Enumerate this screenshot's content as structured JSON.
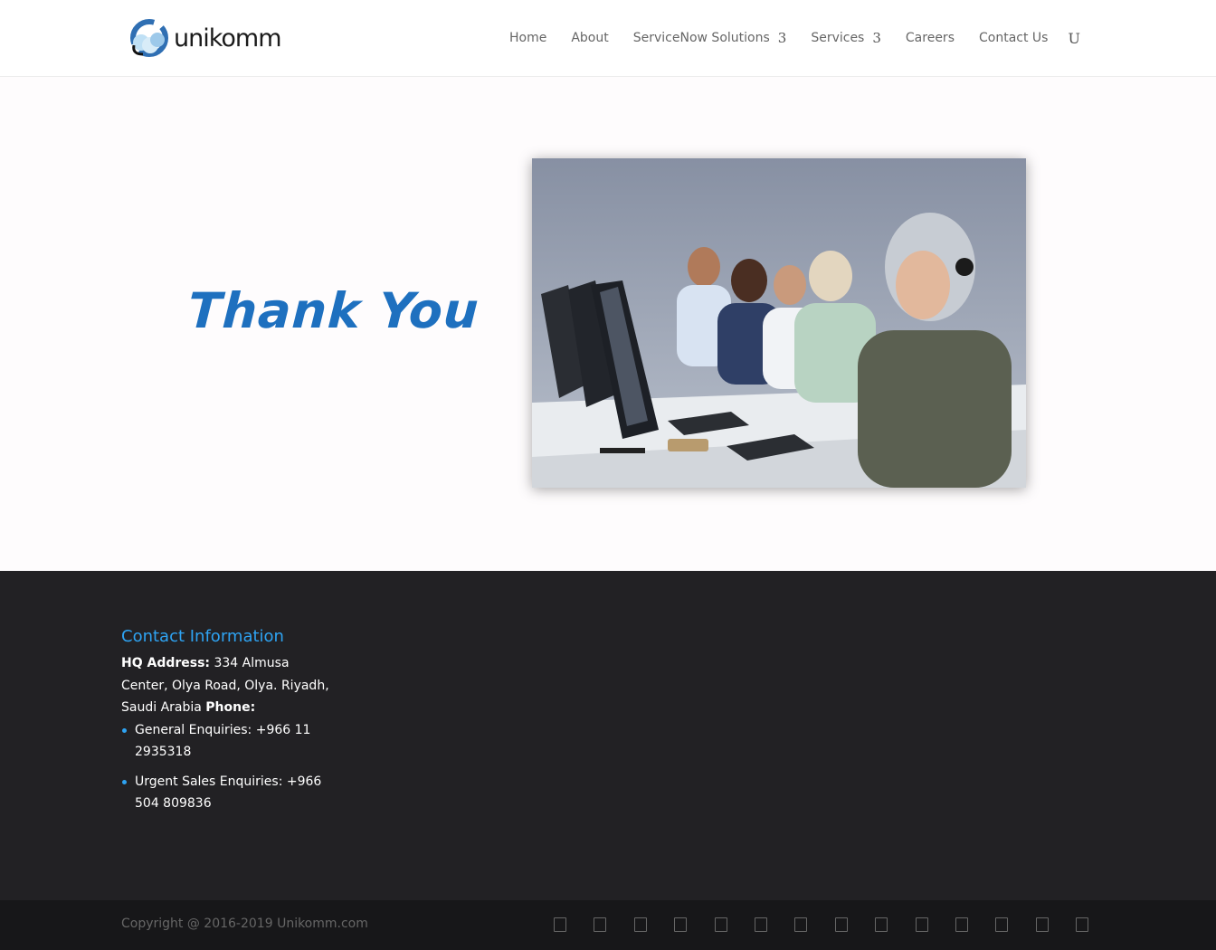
{
  "header": {
    "logo_text": "unikomm",
    "nav": [
      {
        "label": "Home",
        "has_submenu": false
      },
      {
        "label": "About",
        "has_submenu": false
      },
      {
        "label": "ServiceNow Solutions",
        "has_submenu": true,
        "arrow": "3"
      },
      {
        "label": "Services",
        "has_submenu": true,
        "arrow": "3"
      },
      {
        "label": "Careers",
        "has_submenu": false
      },
      {
        "label": "Contact Us",
        "has_submenu": false
      }
    ],
    "search_glyph": "U"
  },
  "hero": {
    "heading": "Thank You",
    "image_icon": "call-center-photo"
  },
  "footer": {
    "contact_title": "Contact Information",
    "hq_label": "HQ Address:",
    "hq_value": " 334 Almusa Center, Olya Road, Olya. Riyadh, Saudi Arabia ",
    "phone_label": "Phone:",
    "phones": [
      "General Enquiries: +966 11 2935318",
      "Urgent Sales Enquiries: +966 504 809836"
    ],
    "copyright": "Copyright @ 2016-2019 Unikomm.com",
    "social_icons": [
      "social-icon-1",
      "social-icon-2",
      "social-icon-3",
      "social-icon-4",
      "social-icon-5",
      "social-icon-6",
      "social-icon-7",
      "social-icon-8",
      "social-icon-9",
      "social-icon-10",
      "social-icon-11",
      "social-icon-12",
      "social-icon-13",
      "social-icon-14"
    ]
  },
  "colors": {
    "accent": "#2ea3f2",
    "heading_blue": "#1e70bf",
    "footer_bg": "#222124",
    "bottom_bar_bg": "#171719"
  }
}
